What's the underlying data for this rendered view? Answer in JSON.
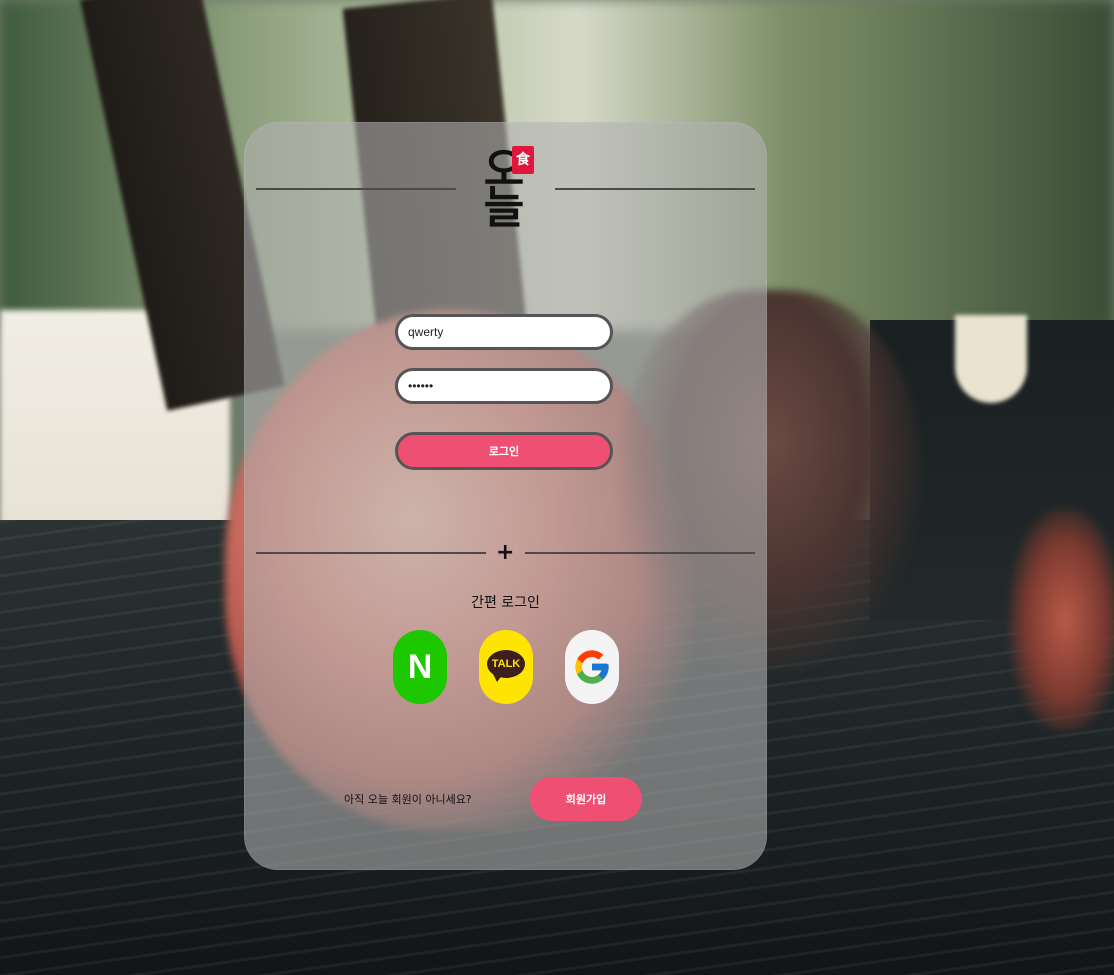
{
  "logo": {
    "text": "오늘",
    "stamp": "食"
  },
  "login_form": {
    "username_value": "qwerty",
    "password_value": "••••••",
    "login_button": "로그인"
  },
  "divider": {
    "symbol": "+"
  },
  "easy_login": {
    "label": "간편 로그인",
    "providers": [
      {
        "name": "naver",
        "glyph": "N",
        "icon": "naver-icon",
        "color": "#1ec800"
      },
      {
        "name": "kakao",
        "glyph": "TALK",
        "icon": "kakao-talk-icon",
        "color": "#fee500"
      },
      {
        "name": "google",
        "glyph": "G",
        "icon": "google-icon",
        "color": "#4285f4"
      }
    ]
  },
  "signup": {
    "question": "아직 오늘 회원이 아니세요?",
    "button": "회원가입"
  },
  "colors": {
    "accent": "#ef4f73",
    "card": "rgba(178,178,178,0.58)"
  }
}
